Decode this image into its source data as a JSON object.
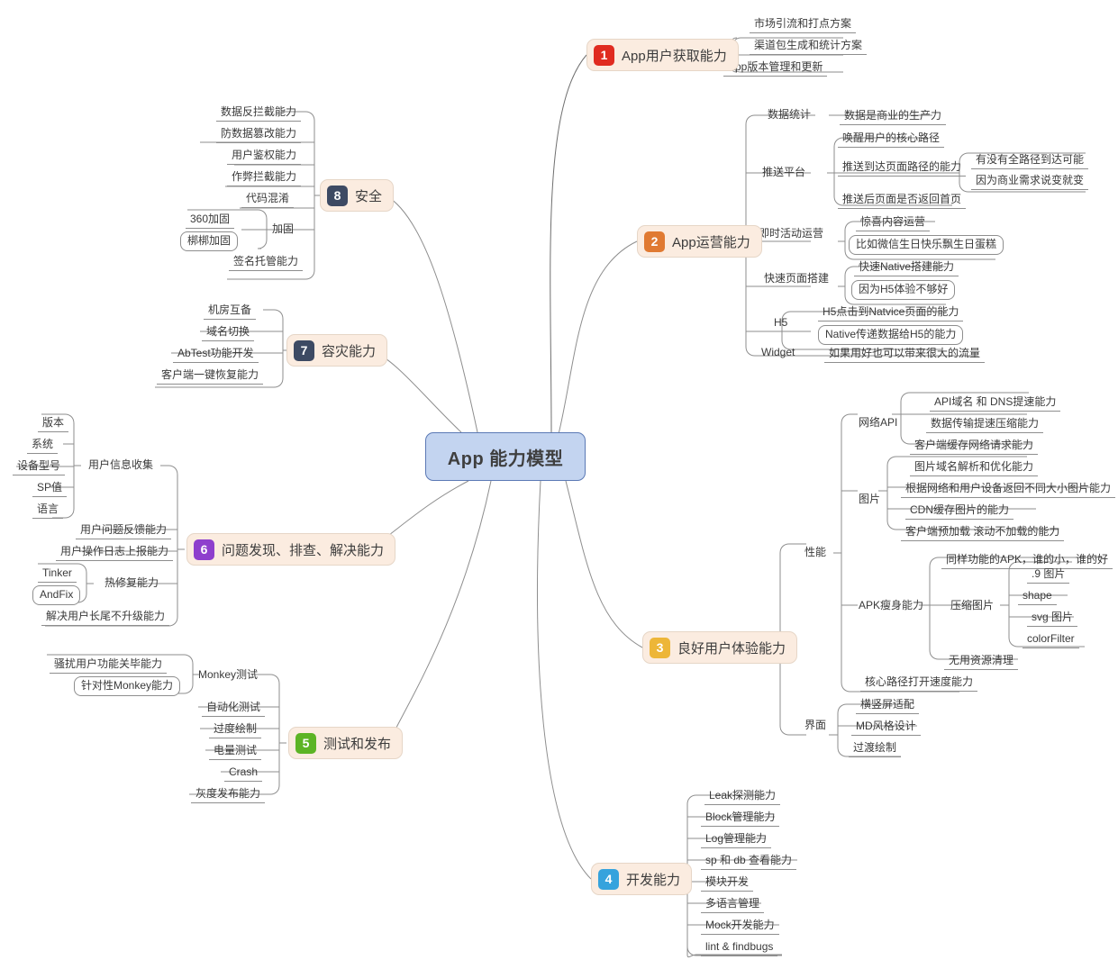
{
  "root": {
    "label": "App 能力模型",
    "fill": "#c3d4f0",
    "stroke": "#5b79b5"
  },
  "branches": [
    {
      "num": "1",
      "label": "App用户获取能力",
      "badge_color": "#e02b20",
      "children": [
        {
          "label": "市场引流和打点方案"
        },
        {
          "label": "渠道包生成和统计方案"
        },
        {
          "label": "App版本管理和更新"
        }
      ]
    },
    {
      "num": "2",
      "label": "App运营能力",
      "badge_color": "#e07a32",
      "children": [
        {
          "label": "数据统计",
          "children": [
            {
              "label": "数据是商业的生产力"
            }
          ]
        },
        {
          "label": "推送平台",
          "children": [
            {
              "label": "唤醒用户的核心路径"
            },
            {
              "label": "推送到达页面路径的能力",
              "children": [
                {
                  "label": "有没有全路径到达可能"
                },
                {
                  "label": "因为商业需求说变就变"
                }
              ]
            },
            {
              "label": "推送后页面是否返回首页"
            }
          ]
        },
        {
          "label": "即时活动运营",
          "children": [
            {
              "label": "惊喜内容运营"
            },
            {
              "label": "比如微信生日快乐飘生日蛋糕"
            }
          ]
        },
        {
          "label": "快速页面搭建",
          "children": [
            {
              "label": "快速Native搭建能力"
            },
            {
              "label": "因为H5体验不够好"
            }
          ]
        },
        {
          "label": "H5",
          "children": [
            {
              "label": "H5点击到Natvice页面的能力"
            },
            {
              "label": "Native传递数据给H5的能力"
            }
          ]
        },
        {
          "label": "Widget",
          "children": [
            {
              "label": "如果用好也可以带来很大的流量"
            }
          ]
        }
      ]
    },
    {
      "num": "3",
      "label": "良好用户体验能力",
      "badge_color": "#edb638",
      "children": [
        {
          "label": "性能",
          "children": [
            {
              "label": "网络API",
              "children": [
                {
                  "label": "API域名 和 DNS提速能力"
                },
                {
                  "label": "数据传输提速压缩能力"
                },
                {
                  "label": "客户端缓存网络请求能力"
                }
              ]
            },
            {
              "label": "图片",
              "children": [
                {
                  "label": "图片域名解析和优化能力"
                },
                {
                  "label": "根据网络和用户设备返回不同大小图片能力"
                },
                {
                  "label": "CDN缓存图片的能力"
                },
                {
                  "label": "客户端预加载 滚动不加载的能力"
                }
              ]
            },
            {
              "label": "APK瘦身能力",
              "children": [
                {
                  "label": "同样功能的APK，谁的小，谁的好"
                },
                {
                  "label": "压缩图片",
                  "children": [
                    {
                      "label": ".9 图片"
                    },
                    {
                      "label": "shape"
                    },
                    {
                      "label": "svg 图片"
                    },
                    {
                      "label": "colorFilter"
                    }
                  ]
                },
                {
                  "label": "无用资源清理"
                }
              ]
            },
            {
              "label": "核心路径打开速度能力"
            }
          ]
        },
        {
          "label": "界面",
          "children": [
            {
              "label": "横竖屏适配"
            },
            {
              "label": "MD风格设计"
            },
            {
              "label": "过渡绘制"
            }
          ]
        }
      ]
    },
    {
      "num": "4",
      "label": "开发能力",
      "badge_color": "#36a3dd",
      "children": [
        {
          "label": "Leak探测能力"
        },
        {
          "label": "Block管理能力"
        },
        {
          "label": "Log管理能力"
        },
        {
          "label": "sp 和 db 查看能力"
        },
        {
          "label": "模块开发"
        },
        {
          "label": "多语言管理"
        },
        {
          "label": "Mock开发能力"
        },
        {
          "label": "lint & findbugs"
        }
      ]
    },
    {
      "num": "5",
      "label": "测试和发布",
      "badge_color": "#5cb425",
      "children": [
        {
          "label": "Monkey测试",
          "children": [
            {
              "label": "骚扰用户功能关毕能力"
            },
            {
              "label": "针对性Monkey能力"
            }
          ]
        },
        {
          "label": "自动化测试"
        },
        {
          "label": "过度绘制"
        },
        {
          "label": "电量测试"
        },
        {
          "label": "Crash"
        },
        {
          "label": "灰度发布能力"
        }
      ]
    },
    {
      "num": "6",
      "label": "问题发现、排查、解决能力",
      "badge_color": "#8e3fcd",
      "children": [
        {
          "label": "用户信息收集",
          "children": [
            {
              "label": "版本"
            },
            {
              "label": "系统"
            },
            {
              "label": "设备型号"
            },
            {
              "label": "SP值"
            },
            {
              "label": "语言"
            }
          ]
        },
        {
          "label": "用户问题反馈能力"
        },
        {
          "label": "用户操作日志上报能力"
        },
        {
          "label": "热修复能力",
          "children": [
            {
              "label": "Tinker"
            },
            {
              "label": "AndFix"
            }
          ]
        },
        {
          "label": "解决用户长尾不升级能力"
        }
      ]
    },
    {
      "num": "7",
      "label": "容灾能力",
      "badge_color": "#3d4a63",
      "children": [
        {
          "label": "机房互备"
        },
        {
          "label": "域名切换"
        },
        {
          "label": "AbTest功能开发"
        },
        {
          "label": "客户端一键恢复能力"
        }
      ]
    },
    {
      "num": "8",
      "label": "安全",
      "badge_color": "#3d4a63",
      "children": [
        {
          "label": "数据反拦截能力"
        },
        {
          "label": "防数据篡改能力"
        },
        {
          "label": "用户鉴权能力"
        },
        {
          "label": "作弊拦截能力"
        },
        {
          "label": "代码混淆"
        },
        {
          "label": "加固",
          "children": [
            {
              "label": "360加固"
            },
            {
              "label": "梆梆加固"
            }
          ]
        },
        {
          "label": "签名托管能力"
        }
      ]
    }
  ]
}
